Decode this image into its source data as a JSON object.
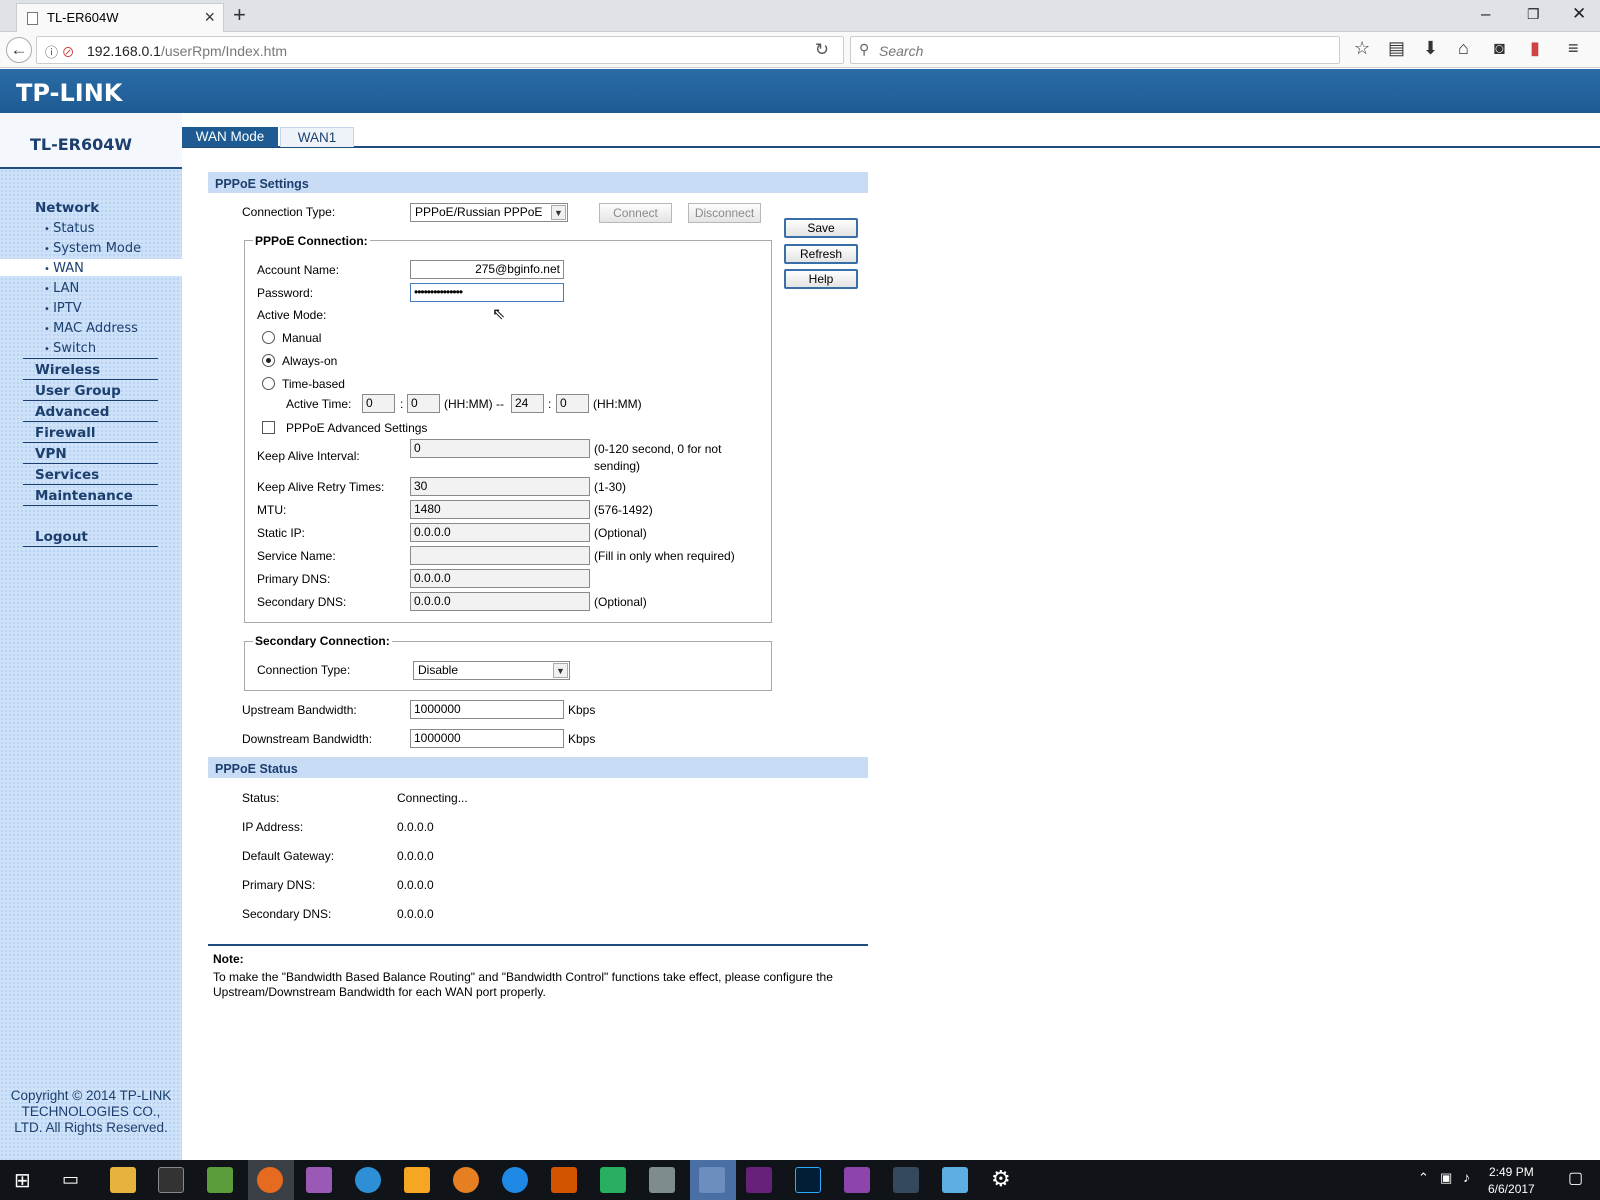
{
  "browser": {
    "tab_title": "TL-ER604W",
    "url_host": "192.168.0.1",
    "url_path": "/userRpm/Index.htm",
    "search_placeholder": "Search"
  },
  "header": {
    "logo": "TP-LINK"
  },
  "sidebar": {
    "model": "TL-ER604W",
    "menu": [
      {
        "label": "Network"
      },
      {
        "label": "Wireless"
      },
      {
        "label": "User Group"
      },
      {
        "label": "Advanced"
      },
      {
        "label": "Firewall"
      },
      {
        "label": "VPN"
      },
      {
        "label": "Services"
      },
      {
        "label": "Maintenance"
      },
      {
        "label": "Logout"
      }
    ],
    "network_items": [
      "Status",
      "System Mode",
      "WAN",
      "LAN",
      "IPTV",
      "MAC Address",
      "Switch"
    ],
    "copyright": "Copyright © 2014 TP-LINK TECHNOLOGIES CO., LTD. All Rights Reserved."
  },
  "tabs": [
    "WAN Mode",
    "WAN1"
  ],
  "pppoe_settings": {
    "title": "PPPoE Settings",
    "connection_type_label": "Connection Type:",
    "connection_type_value": "PPPoE/Russian PPPoE",
    "connect_label": "Connect",
    "disconnect_label": "Disconnect",
    "save_label": "Save",
    "refresh_label": "Refresh",
    "help_label": "Help",
    "connection_legend": "PPPoE Connection:",
    "account_name_label": "Account Name:",
    "account_name_value": "275@bginfo.net",
    "password_label": "Password:",
    "password_value": "•••••••••••••••",
    "active_mode_label": "Active Mode:",
    "mode_manual": "Manual",
    "mode_always_on": "Always-on",
    "mode_time_based": "Time-based",
    "active_time_label": "Active Time:",
    "start_hh": "0",
    "start_mm": "0",
    "hhmm_1": "(HH:MM) --",
    "end_hh": "24",
    "end_mm": "0",
    "hhmm_2": "(HH:MM)",
    "advanced_label": "PPPoE Advanced Settings",
    "keep_alive_interval_label": "Keep Alive Interval:",
    "keep_alive_interval_value": "0",
    "keep_alive_interval_hint": "(0-120 second, 0 for not sending)",
    "keep_alive_retry_label": "Keep Alive Retry Times:",
    "keep_alive_retry_value": "30",
    "keep_alive_retry_hint": "(1-30)",
    "mtu_label": "MTU:",
    "mtu_value": "1480",
    "mtu_hint": "(576-1492)",
    "static_ip_label": "Static IP:",
    "static_ip_value": "0.0.0.0",
    "static_ip_hint": "(Optional)",
    "service_name_label": "Service Name:",
    "service_name_value": "",
    "service_name_hint": "(Fill in only when required)",
    "primary_dns_label": "Primary DNS:",
    "primary_dns_value": "0.0.0.0",
    "secondary_dns_label": "Secondary DNS:",
    "secondary_dns_value": "0.0.0.0",
    "secondary_dns_hint": "(Optional)",
    "secondary_legend": "Secondary Connection:",
    "secondary_conn_type_label": "Connection Type:",
    "secondary_conn_type_value": "Disable",
    "upstream_label": "Upstream Bandwidth:",
    "upstream_value": "1000000",
    "downstream_label": "Downstream Bandwidth:",
    "downstream_value": "1000000",
    "kbps": "Kbps"
  },
  "pppoe_status": {
    "title": "PPPoE Status",
    "rows": [
      {
        "label": "Status:",
        "value": "Connecting..."
      },
      {
        "label": "IP Address:",
        "value": "0.0.0.0"
      },
      {
        "label": "Default Gateway:",
        "value": "0.0.0.0"
      },
      {
        "label": "Primary DNS:",
        "value": "0.0.0.0"
      },
      {
        "label": "Secondary DNS:",
        "value": "0.0.0.0"
      }
    ]
  },
  "note": {
    "title": "Note:",
    "text": "To make the \"Bandwidth Based Balance Routing\" and \"Bandwidth Control\" functions take effect, please configure the Upstream/Downstream Bandwidth for each WAN port properly."
  },
  "taskbar": {
    "time": "2:49 PM",
    "date": "6/6/2017"
  },
  "colors": {
    "header": "#1e5b93",
    "sidebar": "#cfe2f9",
    "section_bar": "#c9dcf5",
    "accent_text": "#1c3f6e"
  }
}
